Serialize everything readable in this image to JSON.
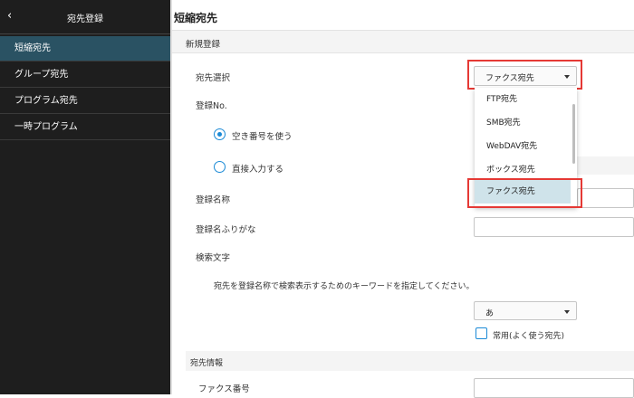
{
  "sidebar": {
    "back_icon": "chevron-left-icon",
    "back_glyph": "‹",
    "title": "宛先登録",
    "items": [
      {
        "label": "短縮宛先",
        "active": true
      },
      {
        "label": "グループ宛先",
        "active": false
      },
      {
        "label": "プログラム宛先",
        "active": false
      },
      {
        "label": "一時プログラム",
        "active": false
      }
    ]
  },
  "main": {
    "title": "短縮宛先",
    "section": "新規登録",
    "dest_select": {
      "label": "宛先選択",
      "value": "ファクス宛先"
    },
    "dropdown": {
      "options": [
        "FTP宛先",
        "SMB宛先",
        "WebDAV宛先",
        "ボックス宛先",
        "ファクス宛先"
      ],
      "selected": "ファクス宛先"
    },
    "reg_no": {
      "label": "登録No."
    },
    "radio_auto": {
      "label": "空き番号を使う",
      "checked": true
    },
    "radio_direct": {
      "label": "直接入力する",
      "checked": false
    },
    "reg_name": {
      "label": "登録名称",
      "value": ""
    },
    "reg_kana": {
      "label": "登録名ふりがな",
      "value": ""
    },
    "search": {
      "label": "検索文字",
      "hint": "宛先を登録名称で検索表示するためのキーワードを指定してください。",
      "value": "あ"
    },
    "common": {
      "label": "常用(よく使う宛先)",
      "checked": false
    },
    "dest_info": {
      "title": "宛先情報"
    },
    "fax_no": {
      "label": "ファクス番号",
      "value": ""
    }
  },
  "colors": {
    "sidebar_bg": "#1e1e1e",
    "sidebar_active": "#2a5263",
    "accent": "#1b8ad6",
    "highlight": "#e53935"
  }
}
